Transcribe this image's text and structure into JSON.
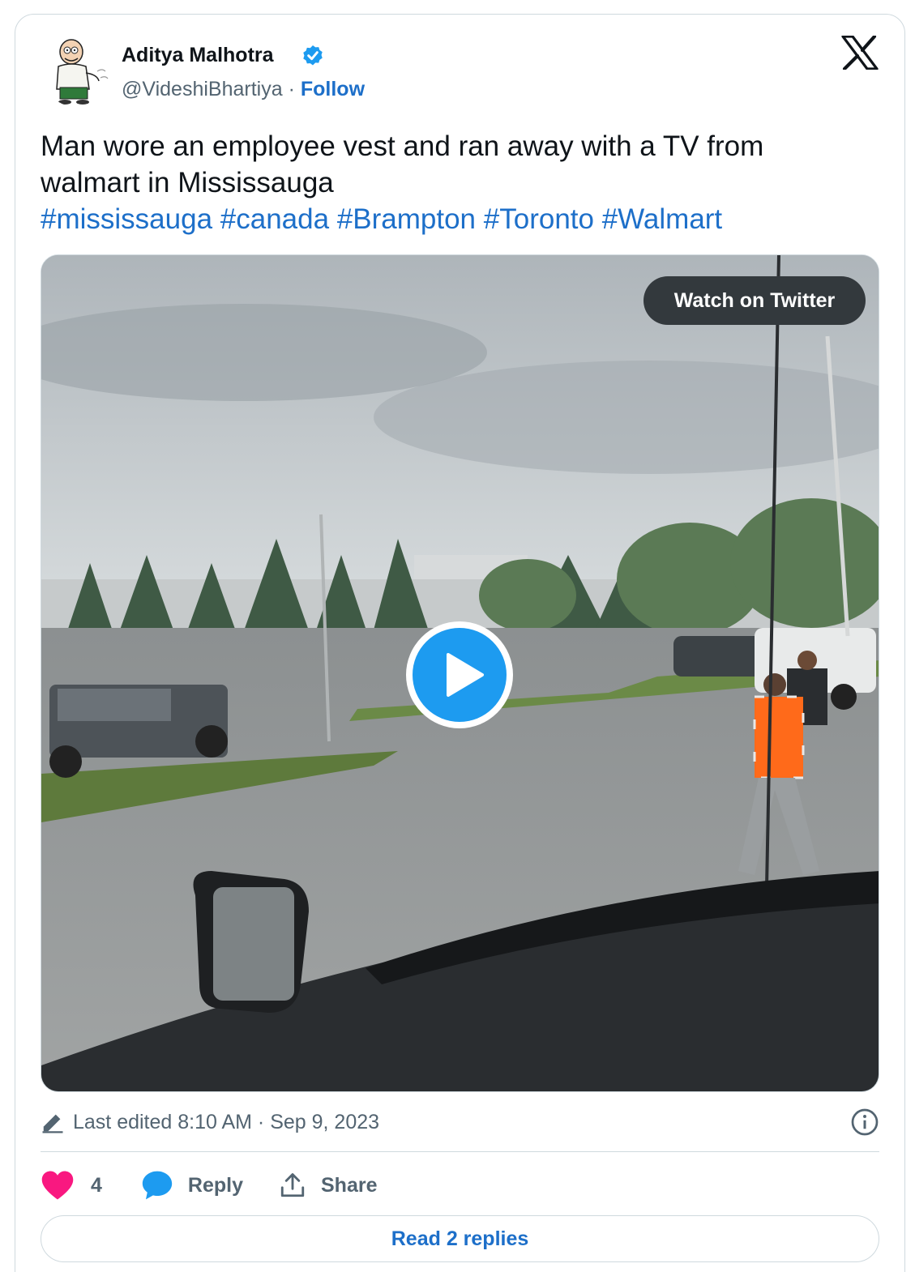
{
  "author": {
    "name": "Aditya Malhotra",
    "handle": "@VideshiBhartiya",
    "separator": "·",
    "follow_label": "Follow",
    "verified": true
  },
  "tweet": {
    "text": "Man wore an employee vest and ran away with a TV from walmart in Mississauga",
    "hashtags": [
      "#mississauga",
      "#canada",
      "#Brampton",
      "#Toronto",
      "#Walmart"
    ]
  },
  "media": {
    "watch_label": "Watch on Twitter"
  },
  "meta": {
    "edited_text": "Last edited 8:10 AM · Sep 9, 2023"
  },
  "actions": {
    "like_count": "4",
    "reply_label": "Reply",
    "share_label": "Share"
  },
  "read_replies_label": "Read 2 replies",
  "colors": {
    "link": "#1d6fc9",
    "like": "#f91880",
    "reply_icon": "#1d9bf0",
    "play": "#1d9bf0",
    "text": "#0f1419",
    "secondary": "#536471"
  },
  "icons": {
    "verified": "verified-badge-icon",
    "platform": "x-logo-icon",
    "edit": "pencil-icon",
    "info": "info-icon",
    "like": "heart-icon",
    "reply": "speech-bubble-icon",
    "share": "share-icon",
    "play": "play-icon"
  }
}
